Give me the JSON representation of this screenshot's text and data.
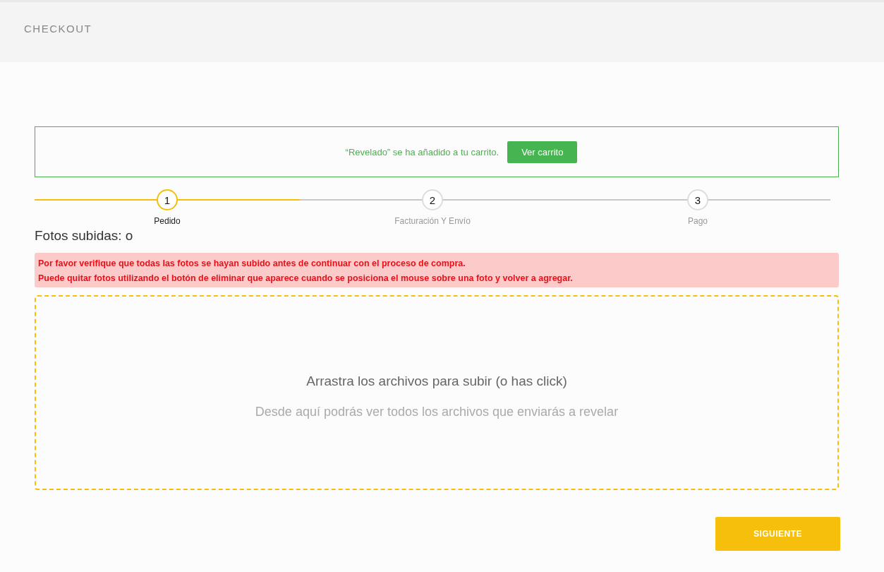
{
  "header": {
    "title": "CHECKOUT"
  },
  "notice": {
    "message": "“Revelado” se ha añadido a tu carrito.",
    "button": "Ver carrito"
  },
  "steps": [
    {
      "number": "1",
      "label": "Pedido",
      "selected": true
    },
    {
      "number": "2",
      "label": "Facturación Y Envío",
      "selected": false
    },
    {
      "number": "3",
      "label": "Pago",
      "selected": false
    }
  ],
  "uploaded_heading": "Fotos subidas: o",
  "alert": [
    "Por favor verifique que todas las fotos se hayan subido antes de continuar con el proceso de compra.",
    "Puede quitar fotos utilizando el botón de eliminar que aparece cuando se posiciona el mouse sobre una foto y volver a agregar."
  ],
  "dropzone": {
    "title": "Arrastra los archivos para subir (o has click)",
    "subtitle": "Desde aquí podrás ver todos los archivos que enviarás a revelar"
  },
  "next_button": "SIGUIENTE"
}
